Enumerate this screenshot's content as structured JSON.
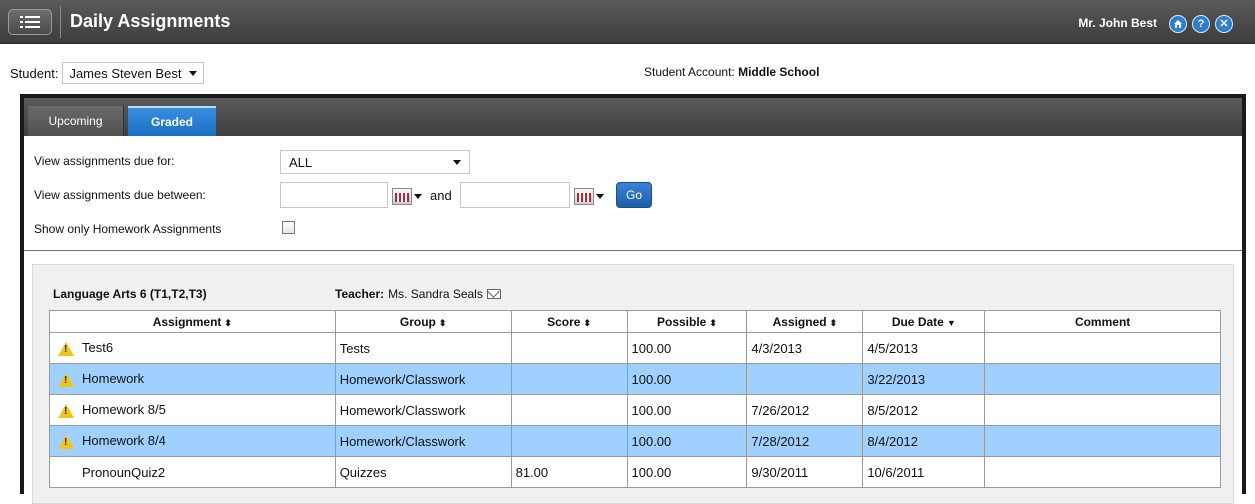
{
  "header": {
    "title": "Daily Assignments",
    "user": "Mr. John Best",
    "icons": [
      "home-icon",
      "help-icon",
      "close-icon"
    ]
  },
  "student": {
    "label": "Student:",
    "selected": "James Steven Best",
    "account_label": "Student Account:",
    "account_value": "Middle School"
  },
  "tabs": [
    {
      "label": "Upcoming",
      "active": false
    },
    {
      "label": "Graded",
      "active": true
    }
  ],
  "filters": {
    "due_for_label": "View assignments due for:",
    "due_for_value": "ALL",
    "between_label": "View assignments due between:",
    "and_label": "and",
    "go_label": "Go",
    "homework_only_label": "Show only Homework Assignments",
    "homework_only_checked": false
  },
  "course": {
    "name": "Language Arts 6 (T1,T2,T3)",
    "teacher_label": "Teacher:",
    "teacher_name": "Ms. Sandra Seals"
  },
  "table": {
    "headers": [
      "Assignment",
      "Group",
      "Score",
      "Possible",
      "Assigned",
      "Due Date",
      "Comment"
    ],
    "rows": [
      {
        "warn": true,
        "assignment": "Test6",
        "group": "Tests",
        "score": "",
        "possible": "100.00",
        "assigned": "4/3/2013",
        "due": "4/5/2013",
        "comment": "",
        "highlight": false
      },
      {
        "warn": true,
        "assignment": "Homework",
        "group": "Homework/Classwork",
        "score": "",
        "possible": "100.00",
        "assigned": "",
        "due": "3/22/2013",
        "comment": "",
        "highlight": true
      },
      {
        "warn": true,
        "assignment": "Homework 8/5",
        "group": "Homework/Classwork",
        "score": "",
        "possible": "100.00",
        "assigned": "7/26/2012",
        "due": "8/5/2012",
        "comment": "",
        "highlight": false
      },
      {
        "warn": true,
        "assignment": "Homework 8/4",
        "group": "Homework/Classwork",
        "score": "",
        "possible": "100.00",
        "assigned": "7/28/2012",
        "due": "8/4/2012",
        "comment": "",
        "highlight": true
      },
      {
        "warn": false,
        "assignment": "PronounQuiz2",
        "group": "Quizzes",
        "score": "81.00",
        "possible": "100.00",
        "assigned": "9/30/2011",
        "due": "10/6/2011",
        "comment": "",
        "highlight": false
      }
    ]
  },
  "colors": {
    "highlight_row": "#9fd0ff",
    "active_tab": "#1b6fc3",
    "title_bar": "#454545"
  }
}
